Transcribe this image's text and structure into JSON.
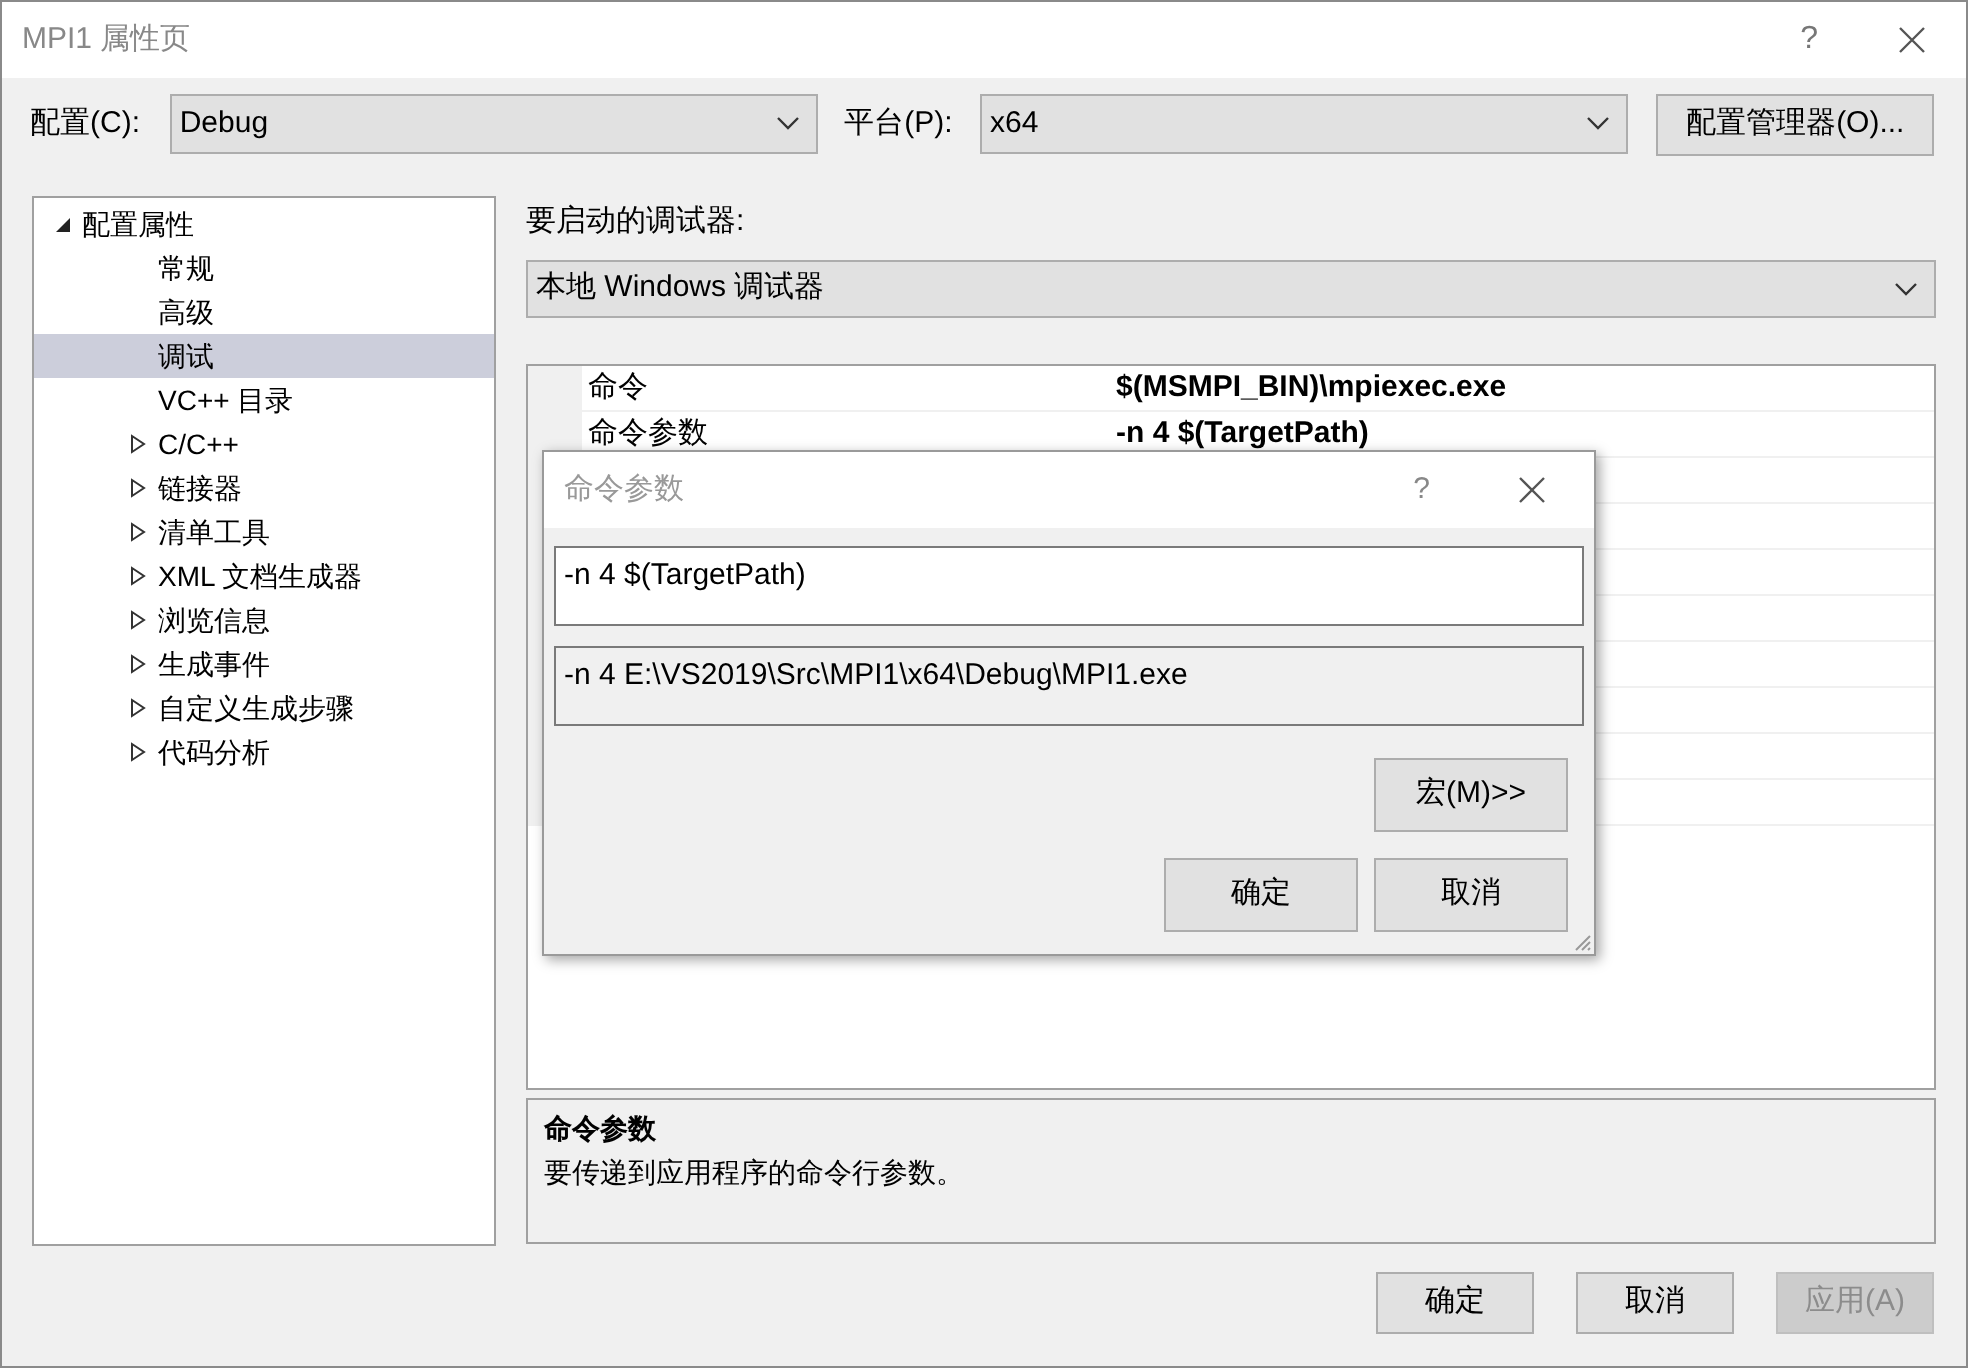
{
  "window": {
    "title": "MPI1 属性页",
    "help": "?"
  },
  "config": {
    "label": "配置(C):",
    "value": "Debug"
  },
  "platform": {
    "label": "平台(P):",
    "value": "x64"
  },
  "config_manager_button": "配置管理器(O)...",
  "tree": [
    {
      "label": "配置属性",
      "expanded": true,
      "selected": false,
      "children": [
        {
          "label": "常规",
          "selected": false
        },
        {
          "label": "高级",
          "selected": false
        },
        {
          "label": "调试",
          "selected": true
        },
        {
          "label": "VC++ 目录",
          "selected": false
        },
        {
          "label": "C/C++",
          "expanded": false,
          "selected": false
        },
        {
          "label": "链接器",
          "expanded": false,
          "selected": false
        },
        {
          "label": "清单工具",
          "expanded": false,
          "selected": false
        },
        {
          "label": "XML 文档生成器",
          "expanded": false,
          "selected": false
        },
        {
          "label": "浏览信息",
          "expanded": false,
          "selected": false
        },
        {
          "label": "生成事件",
          "expanded": false,
          "selected": false
        },
        {
          "label": "自定义生成步骤",
          "expanded": false,
          "selected": false
        },
        {
          "label": "代码分析",
          "expanded": false,
          "selected": false
        }
      ]
    }
  ],
  "debugger": {
    "label": "要启动的调试器:",
    "value": "本地 Windows 调试器"
  },
  "properties": [
    {
      "name": "命令",
      "value": "$(MSMPI_BIN)\\mpiexec.exe"
    },
    {
      "name": "命令参数",
      "value": "-n 4 $(TargetPath)"
    }
  ],
  "description": {
    "title": "命令参数",
    "text": "要传递到应用程序的命令行参数。"
  },
  "buttons": [
    {
      "label": "确定",
      "disabled": false
    },
    {
      "label": "取消",
      "disabled": false
    },
    {
      "label": "应用(A)",
      "disabled": true
    }
  ],
  "dialog": {
    "title": "命令参数",
    "help": "?",
    "value": "-n 4 $(TargetPath)",
    "evaluated": "-n 4 E:\\VS2019\\Src\\MPI1\\x64\\Debug\\MPI1.exe",
    "macros_button": "宏(M)>>",
    "buttons": [
      {
        "label": "确定"
      },
      {
        "label": "取消"
      }
    ]
  }
}
